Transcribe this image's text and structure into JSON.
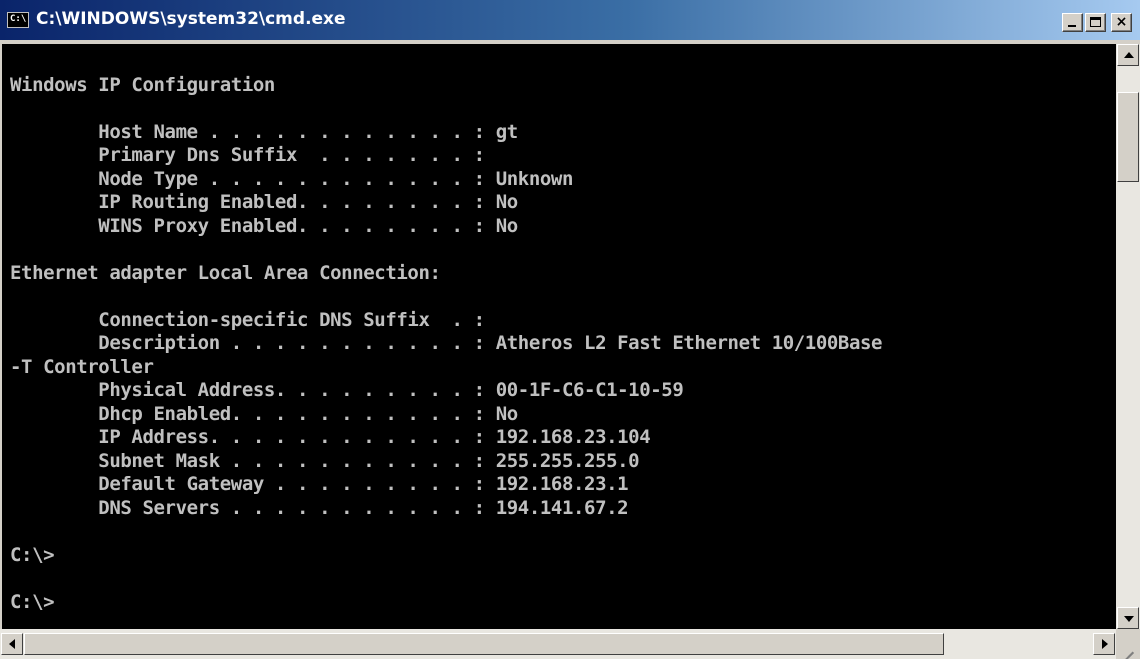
{
  "window": {
    "title": "C:\\WINDOWS\\system32\\cmd.exe",
    "icon_label": "C:\\"
  },
  "console": {
    "lines": [
      "",
      "Windows IP Configuration",
      "",
      "        Host Name . . . . . . . . . . . . : gt",
      "        Primary Dns Suffix  . . . . . . . :",
      "        Node Type . . . . . . . . . . . . : Unknown",
      "        IP Routing Enabled. . . . . . . . : No",
      "        WINS Proxy Enabled. . . . . . . . : No",
      "",
      "Ethernet adapter Local Area Connection:",
      "",
      "        Connection-specific DNS Suffix  . :",
      "        Description . . . . . . . . . . . : Atheros L2 Fast Ethernet 10/100Base",
      "-T Controller",
      "        Physical Address. . . . . . . . . : 00-1F-C6-C1-10-59",
      "        Dhcp Enabled. . . . . . . . . . . : No",
      "        IP Address. . . . . . . . . . . . : 192.168.23.104",
      "        Subnet Mask . . . . . . . . . . . : 255.255.255.0",
      "        Default Gateway . . . . . . . . . : 192.168.23.1",
      "        DNS Servers . . . . . . . . . . . : 194.141.67.2",
      "",
      "C:\\>",
      "",
      "C:\\>"
    ]
  },
  "colors": {
    "console_bg": "#000000",
    "console_text": "#c0c0c0",
    "titlebar_start": "#0a246a",
    "titlebar_end": "#a6caf0",
    "page_bg": "#fffbe6"
  },
  "icons": {
    "app": "cmd-icon",
    "minimize": "minimize-icon",
    "maximize": "maximize-icon",
    "close": "close-icon"
  }
}
